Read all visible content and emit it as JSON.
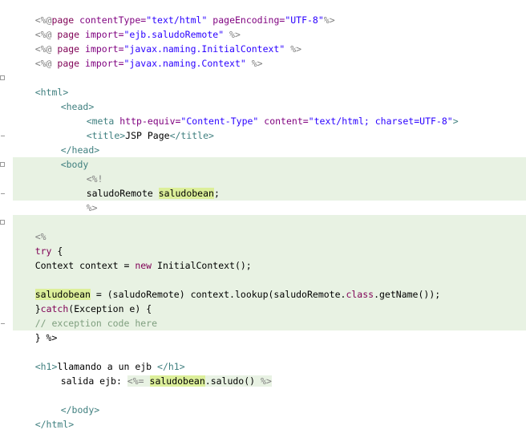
{
  "editor": {
    "lines": {
      "l1": {
        "a": "<%@",
        "b": "page",
        "c": " contentType=",
        "d": "\"text/html\"",
        "e": " pageEncoding=",
        "f": "\"UTF-8\"",
        "g": "%>"
      },
      "l2": {
        "a": "<%@ ",
        "b": "page",
        "c": " import=",
        "d": "\"ejb.saludoRemote\"",
        "e": " %>"
      },
      "l3": {
        "a": "<%@ ",
        "b": "page",
        "c": " import=",
        "d": "\"javax.naming.InitialContext\"",
        "e": " %>"
      },
      "l4": {
        "a": "<%@ ",
        "b": "page",
        "c": " import=",
        "d": "\"javax.naming.Context\"",
        "e": " %>"
      },
      "l6": {
        "a": "<html>"
      },
      "l7": {
        "a": "<head>"
      },
      "l8": {
        "a": "<meta",
        "b": " http-equiv=",
        "c": "\"Content-Type\"",
        "d": " content=",
        "e": "\"text/html; charset=UTF-8\"",
        "f": ">"
      },
      "l9": {
        "a": "<title>",
        "b": "JSP Page",
        "c": "</title>"
      },
      "l10": {
        "a": "</head>"
      },
      "l11": {
        "a": "<body"
      },
      "l12": {
        "a": "<%!"
      },
      "l13": {
        "a": "saludoRemote ",
        "b": "saludobean",
        "c": ";"
      },
      "l14": {
        "a": "%>"
      },
      "l16": {
        "a": "<%"
      },
      "l17": {
        "a": "try",
        "b": " {"
      },
      "l18": {
        "a": "Context context = ",
        "b": "new",
        "c": " InitialContext();"
      },
      "l20": {
        "a": "saludobean",
        "b": " = (saludoRemote) context.lookup(saludoRemote.",
        "c": "class",
        "d": ".getName());"
      },
      "l21": {
        "a": "}",
        "b": "catch",
        "c": "(Exception e) {"
      },
      "l22": {
        "a": "// exception code here"
      },
      "l23": {
        "a": "} %>"
      },
      "l25": {
        "a": "<h1>",
        "b": "llamando a un ejb ",
        "c": "</h1>"
      },
      "l26": {
        "a": "salida ejb: ",
        "b": "<%=",
        "c": " ",
        "d": "saludobean",
        "e": ".saludo() ",
        "f": "%>"
      },
      "l28": {
        "a": "</body>"
      },
      "l29": {
        "a": "</html>"
      }
    }
  }
}
